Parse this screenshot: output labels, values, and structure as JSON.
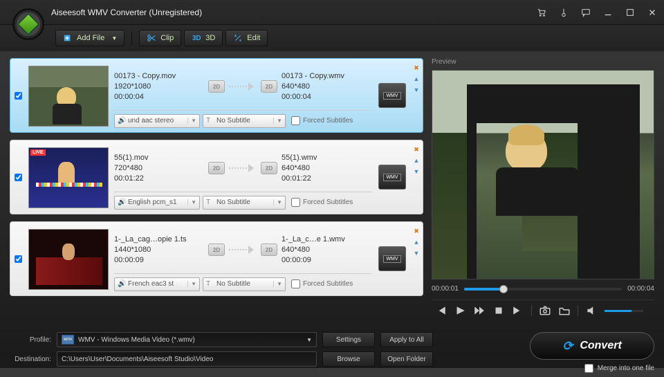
{
  "title": "Aiseesoft WMV Converter (Unregistered)",
  "toolbar": {
    "add_file": "Add File",
    "clip": "Clip",
    "three_d": "3D",
    "edit": "Edit"
  },
  "items": [
    {
      "src_name": "00173 - Copy.mov",
      "src_res": "1920*1080",
      "src_dur": "00:00:04",
      "dst_name": "00173 - Copy.wmv",
      "dst_res": "640*480",
      "dst_dur": "00:00:04",
      "audio": "und aac stereo",
      "subtitle": "No Subtitle",
      "forced": "Forced Subtitles",
      "badge_src": "2D",
      "badge_dst": "2D"
    },
    {
      "src_name": "55(1).mov",
      "src_res": "720*480",
      "src_dur": "00:01:22",
      "dst_name": "55(1).wmv",
      "dst_res": "640*480",
      "dst_dur": "00:01:22",
      "audio": "English pcm_s1",
      "subtitle": "No Subtitle",
      "forced": "Forced Subtitles",
      "badge_src": "2D",
      "badge_dst": "2D"
    },
    {
      "src_name": "1-_La_cag…opie 1.ts",
      "src_res": "1440*1080",
      "src_dur": "00:00:09",
      "dst_name": "1-_La_c…e 1.wmv",
      "dst_res": "640*480",
      "dst_dur": "00:00:09",
      "audio": "French eac3 st",
      "subtitle": "No Subtitle",
      "forced": "Forced Subtitles",
      "badge_src": "2D",
      "badge_dst": "2D"
    }
  ],
  "preview": {
    "label": "Preview",
    "time_cur": "00:00:01",
    "time_total": "00:00:04"
  },
  "profile": {
    "label": "Profile:",
    "value": "WMV - Windows Media Video (*.wmv)",
    "settings": "Settings",
    "apply": "Apply to All"
  },
  "destination": {
    "label": "Destination:",
    "value": "C:\\Users\\User\\Documents\\Aiseesoft Studio\\Video",
    "browse": "Browse",
    "open": "Open Folder"
  },
  "merge_label": "Merge into one file",
  "convert_label": "Convert"
}
